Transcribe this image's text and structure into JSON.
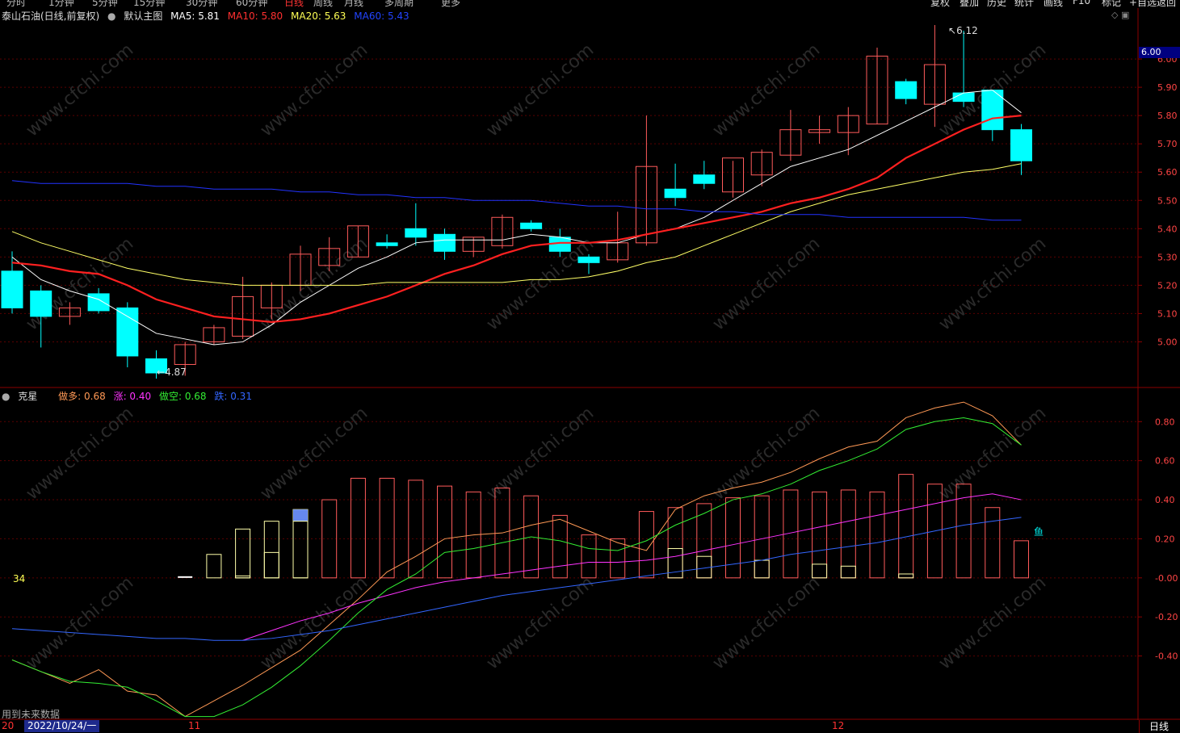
{
  "toolbar": {
    "left_items": [
      "分时",
      "1分钟",
      "5分钟",
      "15分钟",
      "30分钟",
      "60分钟",
      "日线",
      "周线",
      "月线",
      "多周期",
      "更多"
    ],
    "active": "日线",
    "right_items": [
      "复权",
      "叠加",
      "历史",
      "统计",
      "画线",
      "F10",
      "标记",
      "+自选",
      "返回"
    ]
  },
  "main_legend": {
    "title": "泰山石油(日线,前复权)",
    "template": "默认主图",
    "ma5": "MA5: 5.81",
    "ma10": "MA10: 5.80",
    "ma20": "MA20: 5.63",
    "ma60": "MA60: 5.43"
  },
  "ind_legend": {
    "name": "克星",
    "zuoduo": "做多: 0.68",
    "zhang": "涨: 0.40",
    "zuokong": "做空: 0.68",
    "die": "跌: 0.31"
  },
  "labels": {
    "high": "6.12",
    "low": "4.87",
    "current_price": "6.00",
    "ind_value": "34",
    "fish": "鱼",
    "future_note": "用到未来数据",
    "date_prefix": "20",
    "date": "2022/10/24/一",
    "month_11": "11",
    "month_12": "12",
    "period": "日线"
  },
  "colors": {
    "up": "#ff5b5b",
    "down": "#00ffff",
    "ma5": "#ffffff",
    "ma10": "#ff2020",
    "ma20": "#ffff66",
    "ma60": "#2233ff",
    "zuoduo": "#ff9955",
    "zhang": "#ff33ff",
    "zuokong": "#33ee33",
    "die": "#3366ff"
  },
  "chart_data": [
    {
      "type": "candlestick",
      "title": "泰山石油(日线,前复权)",
      "y_ticks": [
        "5.00",
        "5.10",
        "5.20",
        "5.30",
        "5.40",
        "5.50",
        "5.60",
        "5.70",
        "5.80",
        "5.90",
        "6.00"
      ],
      "ylim": [
        4.85,
        6.18
      ],
      "candles": [
        {
          "o": 5.25,
          "h": 5.32,
          "l": 5.1,
          "c": 5.12
        },
        {
          "o": 5.18,
          "h": 5.2,
          "l": 4.98,
          "c": 5.09
        },
        {
          "o": 5.09,
          "h": 5.14,
          "l": 5.06,
          "c": 5.12
        },
        {
          "o": 5.17,
          "h": 5.19,
          "l": 5.1,
          "c": 5.11
        },
        {
          "o": 5.12,
          "h": 5.14,
          "l": 4.91,
          "c": 4.95
        },
        {
          "o": 4.94,
          "h": 4.97,
          "l": 4.87,
          "c": 4.89
        },
        {
          "o": 4.92,
          "h": 5.0,
          "l": 4.88,
          "c": 4.99
        },
        {
          "o": 5.0,
          "h": 5.06,
          "l": 4.99,
          "c": 5.05
        },
        {
          "o": 5.02,
          "h": 5.23,
          "l": 5.01,
          "c": 5.16
        },
        {
          "o": 5.12,
          "h": 5.21,
          "l": 5.08,
          "c": 5.2
        },
        {
          "o": 5.2,
          "h": 5.34,
          "l": 5.18,
          "c": 5.31
        },
        {
          "o": 5.27,
          "h": 5.37,
          "l": 5.25,
          "c": 5.33
        },
        {
          "o": 5.3,
          "h": 5.41,
          "l": 5.3,
          "c": 5.41
        },
        {
          "o": 5.35,
          "h": 5.38,
          "l": 5.33,
          "c": 5.34
        },
        {
          "o": 5.4,
          "h": 5.49,
          "l": 5.34,
          "c": 5.37
        },
        {
          "o": 5.38,
          "h": 5.4,
          "l": 5.29,
          "c": 5.32
        },
        {
          "o": 5.32,
          "h": 5.37,
          "l": 5.3,
          "c": 5.37
        },
        {
          "o": 5.34,
          "h": 5.45,
          "l": 5.33,
          "c": 5.44
        },
        {
          "o": 5.42,
          "h": 5.43,
          "l": 5.39,
          "c": 5.4
        },
        {
          "o": 5.37,
          "h": 5.4,
          "l": 5.3,
          "c": 5.32
        },
        {
          "o": 5.3,
          "h": 5.31,
          "l": 5.24,
          "c": 5.28
        },
        {
          "o": 5.29,
          "h": 5.46,
          "l": 5.28,
          "c": 5.35
        },
        {
          "o": 5.35,
          "h": 5.8,
          "l": 5.34,
          "c": 5.62
        },
        {
          "o": 5.54,
          "h": 5.63,
          "l": 5.48,
          "c": 5.51
        },
        {
          "o": 5.59,
          "h": 5.64,
          "l": 5.54,
          "c": 5.56
        },
        {
          "o": 5.53,
          "h": 5.64,
          "l": 5.51,
          "c": 5.65
        },
        {
          "o": 5.59,
          "h": 5.68,
          "l": 5.55,
          "c": 5.67
        },
        {
          "o": 5.66,
          "h": 5.82,
          "l": 5.64,
          "c": 5.75
        },
        {
          "o": 5.74,
          "h": 5.8,
          "l": 5.7,
          "c": 5.75
        },
        {
          "o": 5.74,
          "h": 5.83,
          "l": 5.66,
          "c": 5.8
        },
        {
          "o": 5.77,
          "h": 6.04,
          "l": 5.77,
          "c": 6.01
        },
        {
          "o": 5.92,
          "h": 5.93,
          "l": 5.84,
          "c": 5.86
        },
        {
          "o": 5.84,
          "h": 6.12,
          "l": 5.76,
          "c": 5.98
        },
        {
          "o": 5.88,
          "h": 6.1,
          "l": 5.83,
          "c": 5.85
        },
        {
          "o": 5.89,
          "h": 5.89,
          "l": 5.71,
          "c": 5.75
        },
        {
          "o": 5.75,
          "h": 5.77,
          "l": 5.59,
          "c": 5.64
        }
      ],
      "series": [
        {
          "name": "MA5",
          "values": [
            5.3,
            5.22,
            5.18,
            5.15,
            5.09,
            5.03,
            5.01,
            4.99,
            5.0,
            5.06,
            5.14,
            5.2,
            5.26,
            5.3,
            5.35,
            5.36,
            5.36,
            5.36,
            5.38,
            5.37,
            5.35,
            5.35,
            5.38,
            5.4,
            5.44,
            5.5,
            5.56,
            5.62,
            5.65,
            5.68,
            5.73,
            5.78,
            5.83,
            5.88,
            5.89,
            5.81
          ]
        },
        {
          "name": "MA10",
          "values": [
            5.28,
            5.27,
            5.25,
            5.24,
            5.2,
            5.15,
            5.12,
            5.09,
            5.08,
            5.07,
            5.08,
            5.1,
            5.13,
            5.16,
            5.2,
            5.24,
            5.27,
            5.31,
            5.34,
            5.35,
            5.35,
            5.36,
            5.38,
            5.4,
            5.42,
            5.44,
            5.46,
            5.49,
            5.51,
            5.54,
            5.58,
            5.65,
            5.7,
            5.75,
            5.79,
            5.8
          ]
        },
        {
          "name": "MA20",
          "values": [
            5.39,
            5.35,
            5.32,
            5.29,
            5.26,
            5.24,
            5.22,
            5.21,
            5.2,
            5.2,
            5.2,
            5.2,
            5.2,
            5.21,
            5.21,
            5.21,
            5.21,
            5.21,
            5.22,
            5.22,
            5.23,
            5.25,
            5.28,
            5.3,
            5.34,
            5.38,
            5.42,
            5.46,
            5.49,
            5.52,
            5.54,
            5.56,
            5.58,
            5.6,
            5.61,
            5.63
          ]
        },
        {
          "name": "MA60",
          "values": [
            5.57,
            5.56,
            5.56,
            5.56,
            5.56,
            5.55,
            5.55,
            5.54,
            5.54,
            5.54,
            5.53,
            5.53,
            5.52,
            5.52,
            5.51,
            5.51,
            5.5,
            5.5,
            5.5,
            5.49,
            5.48,
            5.48,
            5.47,
            5.47,
            5.46,
            5.46,
            5.45,
            5.45,
            5.45,
            5.44,
            5.44,
            5.44,
            5.44,
            5.44,
            5.43,
            5.43
          ]
        }
      ]
    },
    {
      "type": "bar",
      "title": "克星",
      "y_ticks": [
        "-0.40",
        "-0.20",
        "-0.00",
        "0.20",
        "0.40",
        "0.60",
        "0.80"
      ],
      "ylim": [
        -0.72,
        0.95
      ],
      "bars": [
        null,
        null,
        null,
        null,
        null,
        null,
        0.0,
        0.12,
        0.25,
        0.29,
        0.35,
        0.4,
        0.51,
        0.51,
        0.5,
        0.47,
        0.44,
        0.46,
        0.42,
        0.32,
        0.22,
        0.2,
        0.34,
        0.36,
        0.38,
        0.41,
        0.42,
        0.45,
        0.44,
        0.45,
        0.44,
        0.53,
        0.48,
        0.48,
        0.36,
        0.19
      ],
      "inner_bars": [
        null,
        null,
        null,
        null,
        null,
        null,
        null,
        null,
        0.01,
        0.13,
        0.29,
        null,
        null,
        null,
        null,
        null,
        null,
        null,
        null,
        null,
        null,
        null,
        null,
        0.15,
        0.11,
        null,
        0.09,
        null,
        0.07,
        0.06,
        null,
        0.02,
        null,
        null,
        null,
        null
      ],
      "series": [
        {
          "name": "做多",
          "values": [
            -0.42,
            -0.48,
            -0.54,
            -0.47,
            -0.58,
            -0.6,
            -0.71,
            -0.63,
            -0.55,
            -0.46,
            -0.37,
            -0.24,
            -0.11,
            0.03,
            0.11,
            0.2,
            0.22,
            0.23,
            0.27,
            0.3,
            0.24,
            0.18,
            0.14,
            0.35,
            0.42,
            0.46,
            0.49,
            0.54,
            0.61,
            0.67,
            0.7,
            0.82,
            0.87,
            0.9,
            0.83,
            0.68
          ]
        },
        {
          "name": "涨",
          "values": [
            null,
            null,
            null,
            null,
            null,
            null,
            null,
            null,
            -0.32,
            -0.27,
            -0.22,
            -0.18,
            -0.13,
            -0.09,
            -0.05,
            -0.02,
            0.0,
            0.02,
            0.04,
            0.06,
            0.08,
            0.08,
            0.09,
            0.11,
            0.14,
            0.17,
            0.2,
            0.23,
            0.26,
            0.29,
            0.32,
            0.35,
            0.38,
            0.41,
            0.43,
            0.4
          ]
        },
        {
          "name": "做空",
          "values": [
            -0.42,
            -0.48,
            -0.53,
            -0.54,
            -0.56,
            -0.63,
            -0.71,
            -0.71,
            -0.65,
            -0.56,
            -0.45,
            -0.32,
            -0.18,
            -0.06,
            0.02,
            0.13,
            0.15,
            0.18,
            0.21,
            0.19,
            0.15,
            0.14,
            0.19,
            0.27,
            0.33,
            0.4,
            0.43,
            0.48,
            0.55,
            0.6,
            0.66,
            0.76,
            0.8,
            0.82,
            0.79,
            0.68
          ]
        },
        {
          "name": "跌",
          "values": [
            -0.26,
            -0.27,
            -0.28,
            -0.29,
            -0.3,
            -0.31,
            -0.31,
            -0.32,
            -0.32,
            -0.31,
            -0.29,
            -0.27,
            -0.24,
            -0.21,
            -0.18,
            -0.15,
            -0.12,
            -0.09,
            -0.07,
            -0.05,
            -0.03,
            -0.01,
            0.01,
            0.03,
            0.05,
            0.07,
            0.09,
            0.12,
            0.14,
            0.16,
            0.18,
            0.21,
            0.24,
            0.27,
            0.29,
            0.31
          ]
        }
      ]
    }
  ]
}
